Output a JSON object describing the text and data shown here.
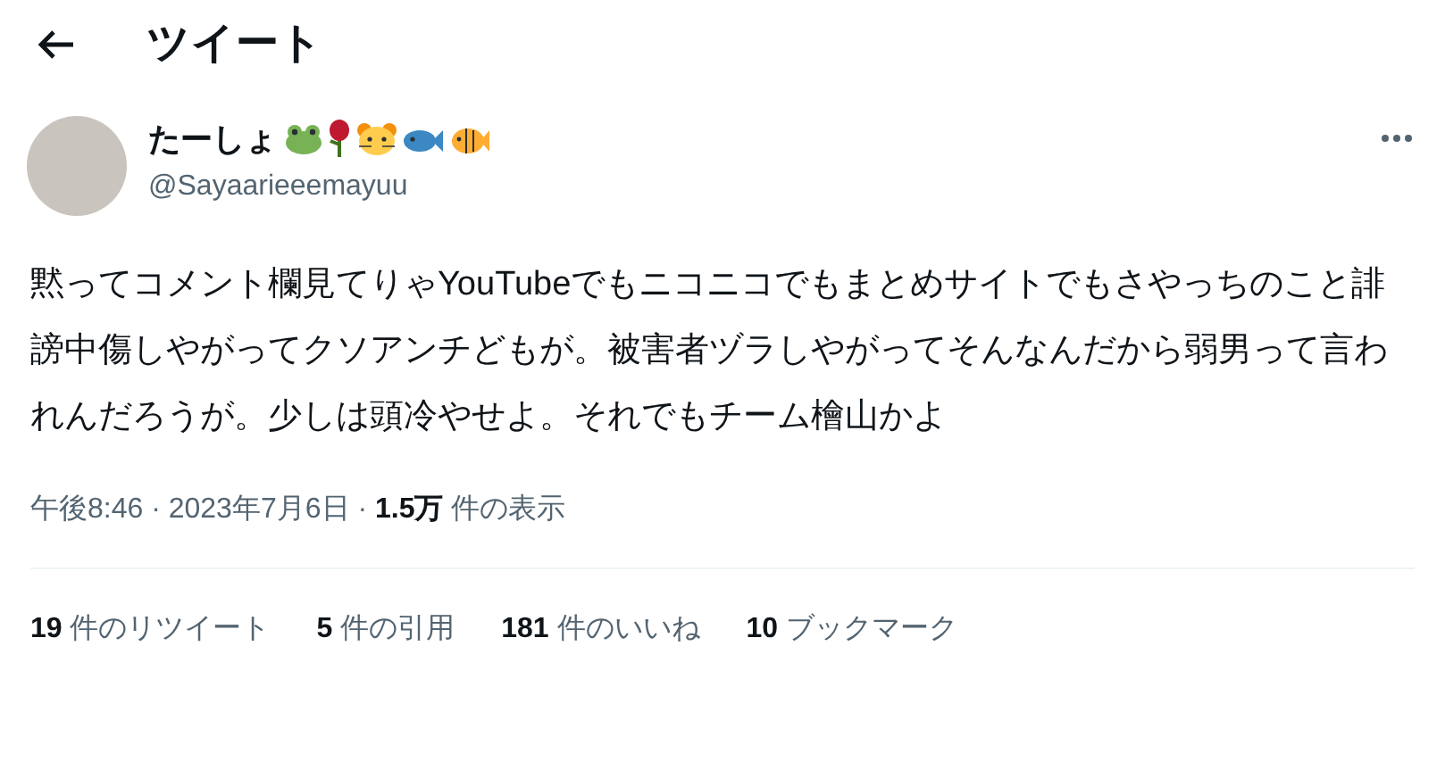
{
  "header": {
    "title": "ツイート"
  },
  "author": {
    "name": "たーしょ",
    "handle": "@Sayaarieeemayuu"
  },
  "tweet": {
    "text": "黙ってコメント欄見てりゃYouTubeでもニコニコでもまとめサイトでもさやっちのこと誹謗中傷しやがってクソアンチどもが。被害者ヅラしやがってそんなんだから弱男って言われんだろうが。少しは頭冷やせよ。それでもチーム檜山かよ"
  },
  "meta": "午後8:46 · 2023年7月6日 · **1.5万** 件の表示",
  "stats": [
    "**19** 件のリツイート",
    "**5** 件の引用",
    "**181** 件のいいね",
    "**10** ブックマーク"
  ]
}
